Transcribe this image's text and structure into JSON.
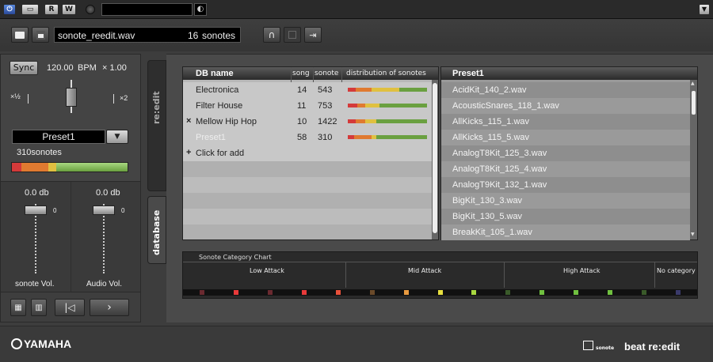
{
  "topbar": {
    "power_icon": "power-icon",
    "buttons": [
      "R",
      "W"
    ]
  },
  "file": {
    "name": "sonote_reedit.wav",
    "count": "16",
    "unit": "sonotes"
  },
  "left": {
    "sync_label": "Sync",
    "bpm": "120.00",
    "bpm_unit": "BPM",
    "multiplier": "× 1.00",
    "half_label": "½",
    "x_label": "×",
    "x2_label": "×2",
    "preset_name": "Preset1",
    "sonotes_count": "310sonotes",
    "fader_sonote": {
      "value": "0.0 db",
      "label": "sonote Vol.",
      "zero": "0"
    },
    "fader_audio": {
      "value": "0.0 db",
      "label": "Audio Vol.",
      "zero": "0"
    }
  },
  "side_tabs": {
    "reedit": "re:edit",
    "database": "database"
  },
  "db_table": {
    "headers": {
      "name": "DB name",
      "song": "song",
      "sonote": "sonote",
      "dist": "distribution of sonotes"
    },
    "rows": [
      {
        "name": "Electronica",
        "song": "14",
        "sonote": "543",
        "marker": ""
      },
      {
        "name": "Filter House",
        "song": "11",
        "sonote": "753",
        "marker": ""
      },
      {
        "name": "Mellow Hip Hop",
        "song": "10",
        "sonote": "1422",
        "marker": "×"
      },
      {
        "name": "Preset1",
        "song": "58",
        "sonote": "310",
        "marker": ""
      }
    ],
    "add_label": "Click for add",
    "add_marker": "+"
  },
  "preset_list": {
    "header": "Preset1",
    "items": [
      "AcidKit_140_2.wav",
      "AcousticSnares_118_1.wav",
      "AllKicks_115_1.wav",
      "AllKicks_115_5.wav",
      "AnalogT8Kit_125_3.wav",
      "AnalogT8Kit_125_4.wav",
      "AnalogT9Kit_132_1.wav",
      "BigKit_130_3.wav",
      "BigKit_130_5.wav",
      "BreakKit_105_1.wav"
    ]
  },
  "category_chart": {
    "title": "Sonote Category Chart",
    "sections": [
      "Low Attack",
      "Mid Attack",
      "High Attack",
      "No category"
    ],
    "dot_colors": [
      "#6a2a30",
      "#e83a3a",
      "#6a2a30",
      "#e83a3a",
      "#e8503a",
      "#6a4a2a",
      "#e89a40",
      "#e8e040",
      "#a8d840",
      "#3a5a2a",
      "#70c040",
      "#70c040",
      "#70c040",
      "#3a5a2a",
      "#3a3a6a"
    ]
  },
  "footer": {
    "brand": "YAMAHA",
    "product_small": "sonote",
    "product": "beat re:edit"
  },
  "colors": {
    "meter_red": "#d43a3a",
    "meter_orange": "#e07a30",
    "meter_yellow": "#e0c040",
    "meter_green": "#8cc060"
  }
}
